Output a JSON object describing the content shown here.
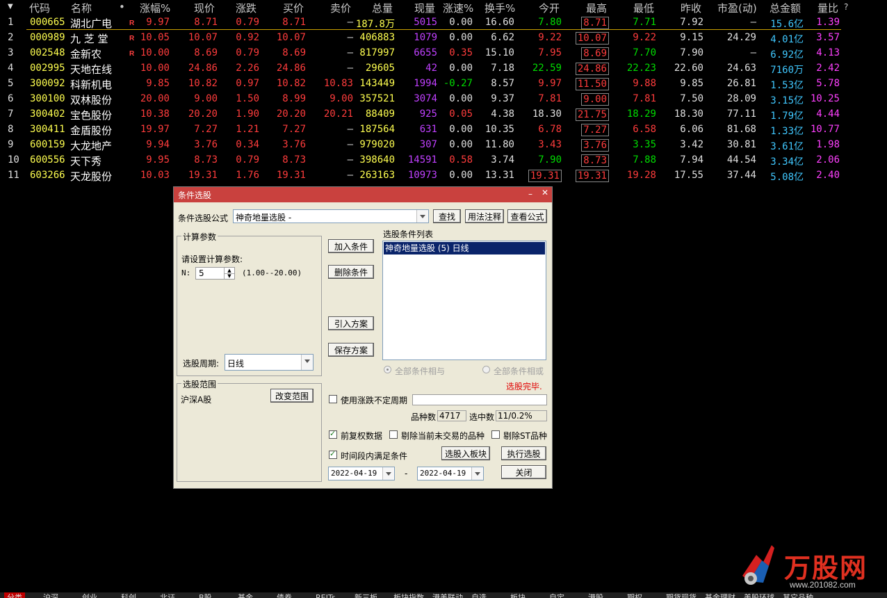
{
  "table": {
    "headers": [
      "代码",
      "名称",
      "•",
      "涨幅%",
      "现价",
      "涨跌",
      "买价",
      "卖价",
      "总量",
      "现量",
      "涨速%",
      "换手%",
      "今开",
      "最高",
      "最低",
      "昨收",
      "市盈(动)",
      "总金额",
      "量比",
      "?"
    ],
    "rows": [
      {
        "idx": "1",
        "code": "000665",
        "name": "湖北广电",
        "r": "R",
        "chg_pct": "9.97",
        "price": "8.71",
        "chg": "0.79",
        "bid": "8.71",
        "ask": "—",
        "vol": "187.8万",
        "cur_vol": "5015",
        "speed": "0.00",
        "turnover": "16.60",
        "open": "7.80",
        "high": "8.71",
        "low": "7.71",
        "prev": "7.92",
        "pe": "—",
        "amount": "15.6亿",
        "vol_ratio": "1.39"
      },
      {
        "idx": "2",
        "code": "000989",
        "name": "九 芝 堂",
        "r": "R",
        "chg_pct": "10.05",
        "price": "10.07",
        "chg": "0.92",
        "bid": "10.07",
        "ask": "—",
        "vol": "406883",
        "cur_vol": "1079",
        "speed": "0.00",
        "turnover": "6.62",
        "open": "9.22",
        "high": "10.07",
        "low": "9.22",
        "prev": "9.15",
        "pe": "24.29",
        "amount": "4.01亿",
        "vol_ratio": "3.57"
      },
      {
        "idx": "3",
        "code": "002548",
        "name": "金新农",
        "r": "R",
        "chg_pct": "10.00",
        "price": "8.69",
        "chg": "0.79",
        "bid": "8.69",
        "ask": "—",
        "vol": "817997",
        "cur_vol": "6655",
        "speed": "0.35",
        "turnover": "15.10",
        "open": "7.95",
        "high": "8.69",
        "low": "7.70",
        "prev": "7.90",
        "pe": "—",
        "amount": "6.92亿",
        "vol_ratio": "4.13"
      },
      {
        "idx": "4",
        "code": "002995",
        "name": "天地在线",
        "r": "",
        "chg_pct": "10.00",
        "price": "24.86",
        "chg": "2.26",
        "bid": "24.86",
        "ask": "—",
        "vol": "29605",
        "cur_vol": "42",
        "speed": "0.00",
        "turnover": "7.18",
        "open": "22.59",
        "high": "24.86",
        "low": "22.23",
        "prev": "22.60",
        "pe": "24.63",
        "amount": "7160万",
        "vol_ratio": "2.42"
      },
      {
        "idx": "5",
        "code": "300092",
        "name": "科新机电",
        "r": "",
        "chg_pct": "9.85",
        "price": "10.82",
        "chg": "0.97",
        "bid": "10.82",
        "ask": "10.83",
        "vol": "143449",
        "cur_vol": "1994",
        "speed": "-0.27",
        "turnover": "8.57",
        "open": "9.97",
        "high": "11.50",
        "low": "9.88",
        "prev": "9.85",
        "pe": "26.81",
        "amount": "1.53亿",
        "vol_ratio": "5.78"
      },
      {
        "idx": "6",
        "code": "300100",
        "name": "双林股份",
        "r": "",
        "chg_pct": "20.00",
        "price": "9.00",
        "chg": "1.50",
        "bid": "8.99",
        "ask": "9.00",
        "vol": "357521",
        "cur_vol": "3074",
        "speed": "0.00",
        "turnover": "9.37",
        "open": "7.81",
        "high": "9.00",
        "low": "7.81",
        "prev": "7.50",
        "pe": "28.09",
        "amount": "3.15亿",
        "vol_ratio": "10.25"
      },
      {
        "idx": "7",
        "code": "300402",
        "name": "宝色股份",
        "r": "",
        "chg_pct": "10.38",
        "price": "20.20",
        "chg": "1.90",
        "bid": "20.20",
        "ask": "20.21",
        "vol": "88409",
        "cur_vol": "925",
        "speed": "0.05",
        "turnover": "4.38",
        "open": "18.30",
        "high": "21.75",
        "low": "18.29",
        "prev": "18.30",
        "pe": "77.11",
        "amount": "1.79亿",
        "vol_ratio": "4.44"
      },
      {
        "idx": "8",
        "code": "300411",
        "name": "金盾股份",
        "r": "",
        "chg_pct": "19.97",
        "price": "7.27",
        "chg": "1.21",
        "bid": "7.27",
        "ask": "—",
        "vol": "187564",
        "cur_vol": "631",
        "speed": "0.00",
        "turnover": "10.35",
        "open": "6.78",
        "high": "7.27",
        "low": "6.58",
        "prev": "6.06",
        "pe": "81.68",
        "amount": "1.33亿",
        "vol_ratio": "10.77"
      },
      {
        "idx": "9",
        "code": "600159",
        "name": "大龙地产",
        "r": "",
        "chg_pct": "9.94",
        "price": "3.76",
        "chg": "0.34",
        "bid": "3.76",
        "ask": "—",
        "vol": "979020",
        "cur_vol": "307",
        "speed": "0.00",
        "turnover": "11.80",
        "open": "3.43",
        "high": "3.76",
        "low": "3.35",
        "prev": "3.42",
        "pe": "30.81",
        "amount": "3.61亿",
        "vol_ratio": "1.98"
      },
      {
        "idx": "10",
        "code": "600556",
        "name": "天下秀",
        "r": "",
        "chg_pct": "9.95",
        "price": "8.73",
        "chg": "0.79",
        "bid": "8.73",
        "ask": "—",
        "vol": "398640",
        "cur_vol": "14591",
        "speed": "0.58",
        "turnover": "3.74",
        "open": "7.90",
        "high": "8.73",
        "low": "7.88",
        "prev": "7.94",
        "pe": "44.54",
        "amount": "3.34亿",
        "vol_ratio": "2.06"
      },
      {
        "idx": "11",
        "code": "603266",
        "name": "天龙股份",
        "r": "",
        "chg_pct": "10.03",
        "price": "19.31",
        "chg": "1.76",
        "bid": "19.31",
        "ask": "—",
        "vol": "263163",
        "cur_vol": "10973",
        "speed": "0.00",
        "turnover": "13.31",
        "open": "19.31",
        "high": "19.31",
        "low": "19.28",
        "prev": "17.55",
        "pe": "37.44",
        "amount": "5.08亿",
        "vol_ratio": "2.40"
      }
    ]
  },
  "dialog": {
    "title": "条件选股",
    "formula_label": "条件选股公式",
    "formula_value": "神奇地量选股 -",
    "btn_find": "查找",
    "btn_usage": "用法注释",
    "btn_view": "查看公式",
    "calc_group": "计算参数",
    "calc_prompt": "请设置计算参数:",
    "param_name": "N:",
    "param_value": "5",
    "param_range": "(1.00--20.00)",
    "period_label": "选股周期:",
    "period_value": "日线",
    "btn_add": "加入条件",
    "btn_delete": "删除条件",
    "btn_import": "引入方案",
    "btn_save": "保存方案",
    "cond_list_label": "选股条件列表",
    "cond_items": [
      "神奇地量选股 (5) 日线"
    ],
    "radio_and": "全部条件相与",
    "radio_or": "全部条件相或",
    "status": "选股完毕.",
    "scope_group": "选股范围",
    "scope_value": "沪深A股",
    "btn_scope": "改变范围",
    "chk_indef": "使用涨跌不定周期",
    "count_label": "品种数",
    "count_value": "4717",
    "selected_label": "选中数",
    "selected_value": "11/0.2%",
    "chk_fq": "前复权数据",
    "chk_exclude_untraded": "剔除当前未交易的品种",
    "chk_exclude_st": "剔除ST品种",
    "chk_period": "时间段内满足条件",
    "btn_to_block": "选股入板块",
    "btn_run": "执行选股",
    "date_from": "2022-04-19",
    "date_sep": "-",
    "date_to": "2022-04-19",
    "btn_close": "关闭"
  },
  "watermark": {
    "brand": "万股网",
    "url": "www.201082.com"
  },
  "bottom_tabs": [
    "分类",
    "沪深",
    "创业",
    "科创",
    "北证",
    "B股",
    "基金",
    "债券",
    "REITs",
    "新三板",
    "板块指数",
    "港美联动",
    "自选",
    "板块",
    "自定",
    "港股",
    "期权",
    "期货现货",
    "基金理财",
    "美股环球",
    "其它品种"
  ],
  "colors": {
    "up": "#ff3c3c",
    "down": "#00dd00",
    "code": "#ffff50",
    "title_bar": "#c9413e",
    "list_selected": "#0a246a"
  }
}
